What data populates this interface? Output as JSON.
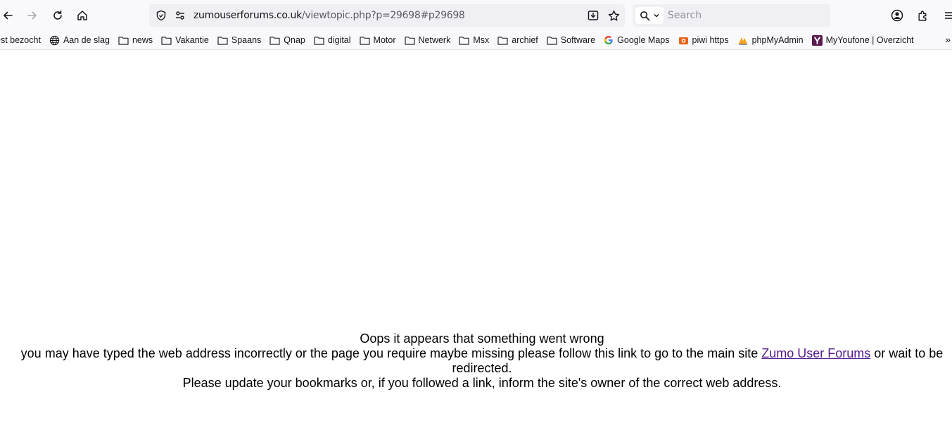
{
  "browser": {
    "url_domain": "zumouserforums.co.uk",
    "url_path": "/viewtopic.php?p=29698#p29698",
    "search_placeholder": "Search"
  },
  "bookmarks": [
    {
      "label": "est bezocht",
      "icon": "none"
    },
    {
      "label": "Aan de slag",
      "icon": "globe-icon"
    },
    {
      "label": "news",
      "icon": "folder-icon"
    },
    {
      "label": "Vakantie",
      "icon": "folder-icon"
    },
    {
      "label": "Spaans",
      "icon": "folder-icon"
    },
    {
      "label": "Qnap",
      "icon": "folder-icon"
    },
    {
      "label": "digital",
      "icon": "folder-icon"
    },
    {
      "label": "Motor",
      "icon": "folder-icon"
    },
    {
      "label": "Netwerk",
      "icon": "folder-icon"
    },
    {
      "label": "Msx",
      "icon": "folder-icon"
    },
    {
      "label": "archief",
      "icon": "folder-icon"
    },
    {
      "label": "Software",
      "icon": "folder-icon"
    },
    {
      "label": "Google Maps",
      "icon": "google-icon"
    },
    {
      "label": "piwi https",
      "icon": "piwi-icon"
    },
    {
      "label": "phpMyAdmin",
      "icon": "phpmyadmin-icon"
    },
    {
      "label": "MyYoufone | Overzicht",
      "icon": "youfone-icon"
    }
  ],
  "page": {
    "line1": "Oops it appears that something went wrong",
    "line2_before": "you may have typed the web address incorrectly or the page you require maybe missing please follow this link to go to the main site ",
    "link_text": "Zumo User Forums",
    "line2_after": " or wait to be redirected.",
    "line3": "Please update your bookmarks or, if you followed a link, inform the site's owner of the correct web address."
  },
  "colors": {
    "link": "#551a8b",
    "toolbar_bg": "#f9f9fb",
    "urlbar_bg": "#f0f0f4"
  }
}
